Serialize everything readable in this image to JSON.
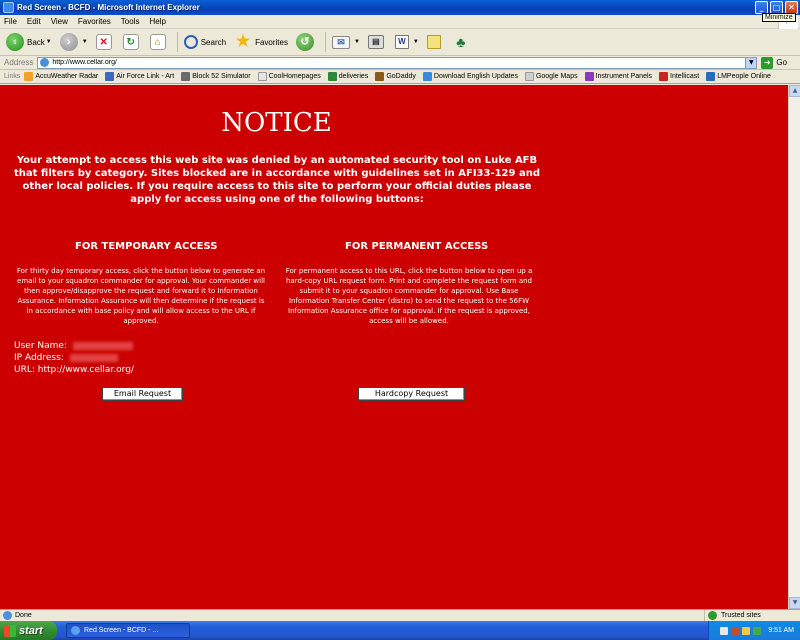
{
  "window": {
    "title": "Red Screen - BCFD - Microsoft Internet Explorer",
    "tooltip": "Minimize"
  },
  "menu": [
    "File",
    "Edit",
    "View",
    "Favorites",
    "Tools",
    "Help"
  ],
  "toolbar": {
    "back_label": "Back",
    "search_label": "Search",
    "favorites_label": "Favorites"
  },
  "address": {
    "label": "Address",
    "url": "http://www.cellar.org/",
    "go_label": "Go"
  },
  "links": {
    "label": "Links",
    "items": [
      "AccuWeather Radar",
      "Air Force Link - Art",
      "Block 52 Simulator",
      "CoolHomepages",
      "deliveries",
      "GoDaddy",
      "Download English Updates",
      "Google Maps",
      "Instrument Panels",
      "Intellicast",
      "LMPeople Online"
    ]
  },
  "page": {
    "heading": "NOTICE",
    "body": "Your attempt to access this web site was denied by an automated security tool on Luke AFB that filters by category. Sites blocked are in accordance with guidelines set in AFI33-129 and other local policies. If you require access to this site to perform your official duties please apply for access using one of the following buttons:",
    "temporary": {
      "heading": "FOR TEMPORARY ACCESS",
      "text": "For thirty day temporary access, click the button below to generate an email to your squadron commander for approval. Your commander will then approve/disapprove the request and forward it to Information Assurance. Information Assurance will then determine if the request is in accordance with base policy and will allow access to the URL if approved.",
      "button": "Email Request"
    },
    "permanent": {
      "heading": "FOR PERMANENT ACCESS",
      "text": "For permanent access to this URL, click the button below to open up a hard-copy URL request form. Print and complete the request form and submit it to your squadron commander for approval. Use Base Information Transfer Center (distro) to send the request to the 56FW Information Assurance office for approval. If the request is approved, access will be allowed.",
      "button": "Hardcopy Request"
    },
    "user_label": "User Name:",
    "ip_label": "IP Address:",
    "url_line": "URL: http://www.cellar.org/"
  },
  "status": {
    "text": "Done",
    "zone": "Trusted sites"
  },
  "taskbar": {
    "start": "start",
    "task": "Red Screen - BCFD - ...",
    "clock": "9:51 AM"
  }
}
